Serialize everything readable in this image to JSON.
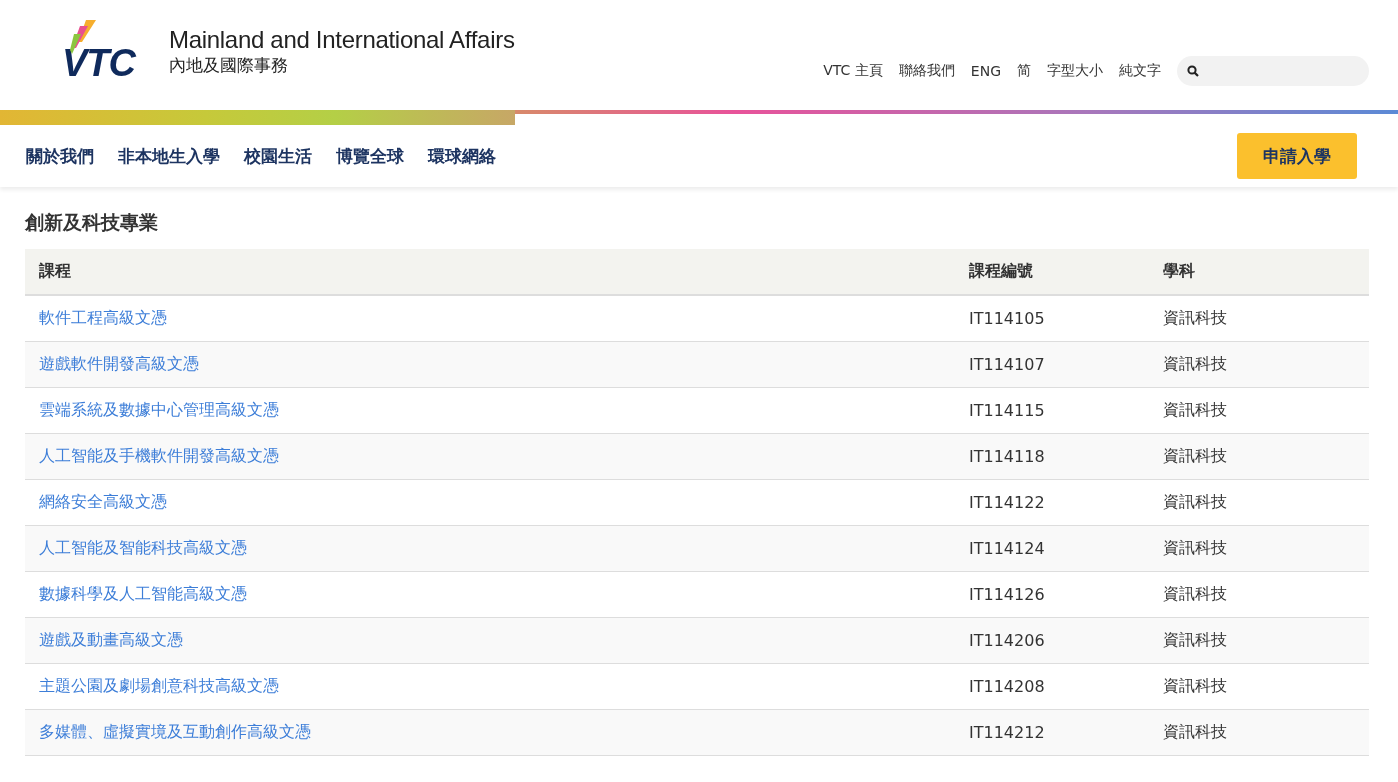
{
  "logo": {
    "text": "VTC"
  },
  "site_title": {
    "english": "Mainland and International Affairs",
    "chinese": "內地及國際事務"
  },
  "top_links": [
    "VTC 主頁",
    "聯絡我們",
    "ENG",
    "简",
    "字型大小",
    "純文字"
  ],
  "nav": [
    "關於我們",
    "非本地生入學",
    "校園生活",
    "博覽全球",
    "環球網絡"
  ],
  "apply_button": "申請入學",
  "section_title": "創新及科技專業",
  "table": {
    "columns": [
      "課程",
      "課程編號",
      "學科"
    ],
    "rows": [
      {
        "course": "軟件工程高級文憑",
        "code": "IT114105",
        "subject": "資訊科技"
      },
      {
        "course": "遊戲軟件開發高級文憑",
        "code": "IT114107",
        "subject": "資訊科技"
      },
      {
        "course": "雲端系統及數據中心管理高級文憑",
        "code": "IT114115",
        "subject": "資訊科技"
      },
      {
        "course": "人工智能及手機軟件開發高級文憑",
        "code": "IT114118",
        "subject": "資訊科技"
      },
      {
        "course": "網絡安全高級文憑",
        "code": "IT114122",
        "subject": "資訊科技"
      },
      {
        "course": "人工智能及智能科技高級文憑",
        "code": "IT114124",
        "subject": "資訊科技"
      },
      {
        "course": "數據科學及人工智能高級文憑",
        "code": "IT114126",
        "subject": "資訊科技"
      },
      {
        "course": "遊戲及動畫高級文憑",
        "code": "IT114206",
        "subject": "資訊科技"
      },
      {
        "course": "主題公園及劇場創意科技高級文憑",
        "code": "IT114208",
        "subject": "資訊科技"
      },
      {
        "course": "多媒體、虛擬實境及互動創作高級文憑",
        "code": "IT114212",
        "subject": "資訊科技"
      }
    ]
  }
}
